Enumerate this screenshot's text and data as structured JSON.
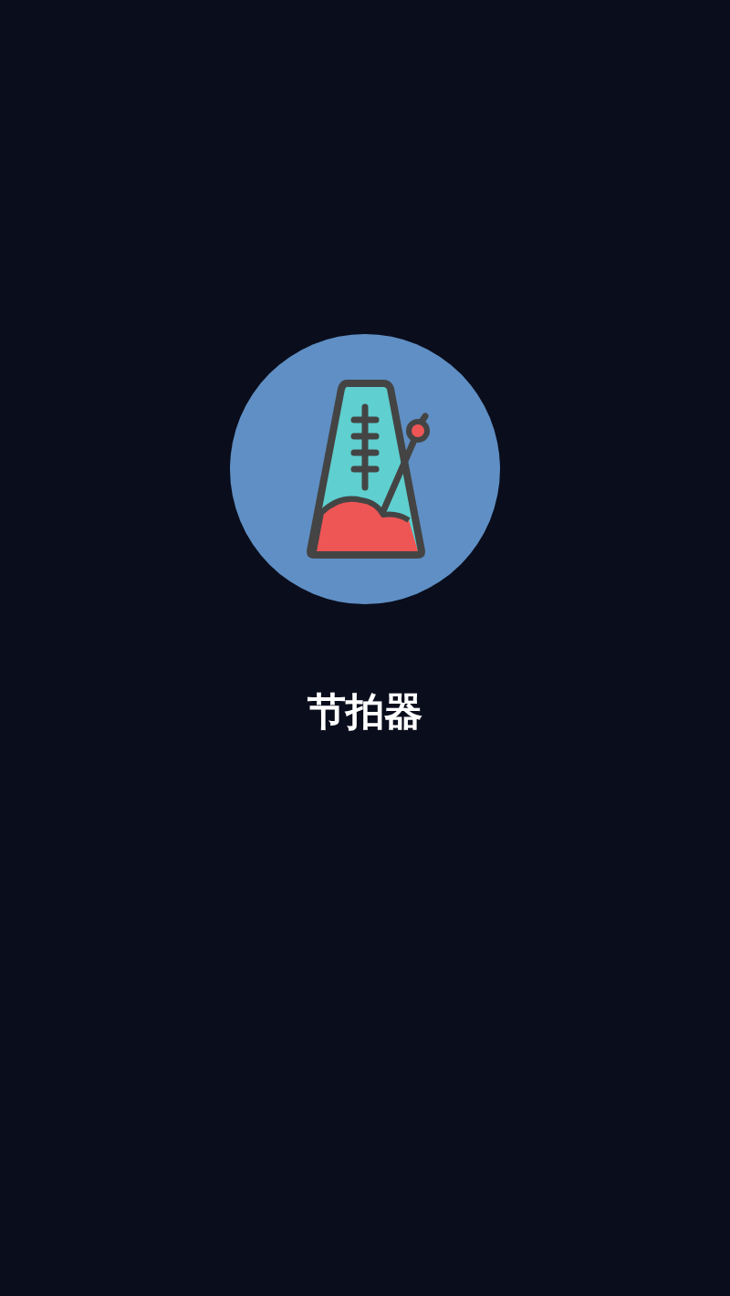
{
  "app": {
    "title": "节拍器"
  }
}
